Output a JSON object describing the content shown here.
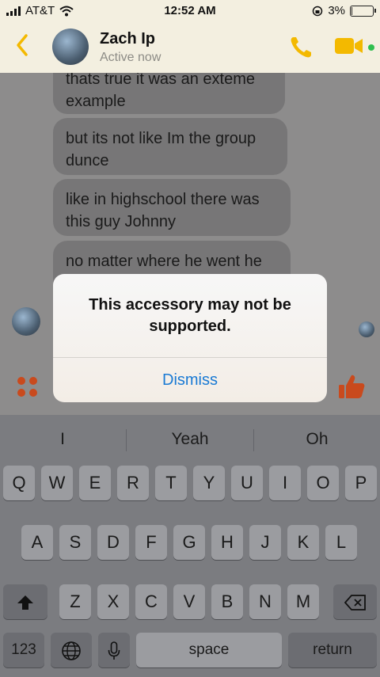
{
  "status_bar": {
    "carrier": "AT&T",
    "time": "12:52 AM",
    "battery_percent": "3%",
    "battery_level": 0.03
  },
  "header": {
    "contact_name": "Zach Ip",
    "status": "Active now"
  },
  "messages": [
    "thats true it was an exteme example",
    "but its not like Im the group dunce",
    "like in highschool there was this guy Johnny",
    "no matter where he went he"
  ],
  "alert": {
    "message": "This accessory may not be supported.",
    "dismiss_label": "Dismiss"
  },
  "keyboard": {
    "predictions": [
      "I",
      "Yeah",
      "Oh"
    ],
    "row1": [
      "Q",
      "W",
      "E",
      "R",
      "T",
      "Y",
      "U",
      "I",
      "O",
      "P"
    ],
    "row2": [
      "A",
      "S",
      "D",
      "F",
      "G",
      "H",
      "J",
      "K",
      "L"
    ],
    "row3": [
      "Z",
      "X",
      "C",
      "V",
      "B",
      "N",
      "M"
    ],
    "numbers_label": "123",
    "space_label": "space",
    "return_label": "return"
  },
  "colors": {
    "accent": "#f3b900",
    "action": "#c94a1d",
    "link": "#1a7ad4"
  }
}
